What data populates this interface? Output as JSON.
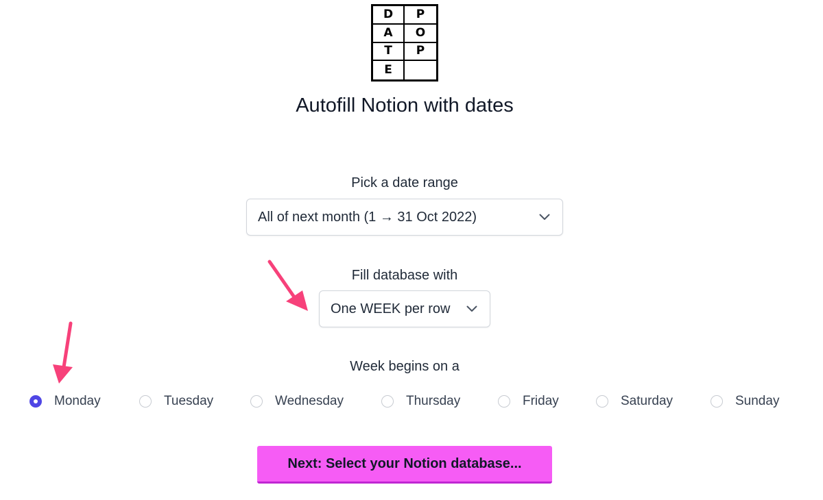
{
  "logo": {
    "letters": [
      "D",
      "P",
      "A",
      "O",
      "T",
      "P",
      "E",
      ""
    ]
  },
  "title": "Autofill Notion with dates",
  "date_range": {
    "label": "Pick a date range",
    "selected": "All of next month (1 → 31 Oct 2022)"
  },
  "fill": {
    "label": "Fill database with",
    "selected": "One WEEK per row"
  },
  "week_start": {
    "label": "Week begins on a",
    "options": [
      "Monday",
      "Tuesday",
      "Wednesday",
      "Thursday",
      "Friday",
      "Saturday",
      "Sunday"
    ],
    "selected": "Monday"
  },
  "next_button": "Next: Select your Notion database...",
  "colors": {
    "accent": "#4f46e5",
    "button": "#f65cf5",
    "annotation_arrow": "#f7417a"
  }
}
